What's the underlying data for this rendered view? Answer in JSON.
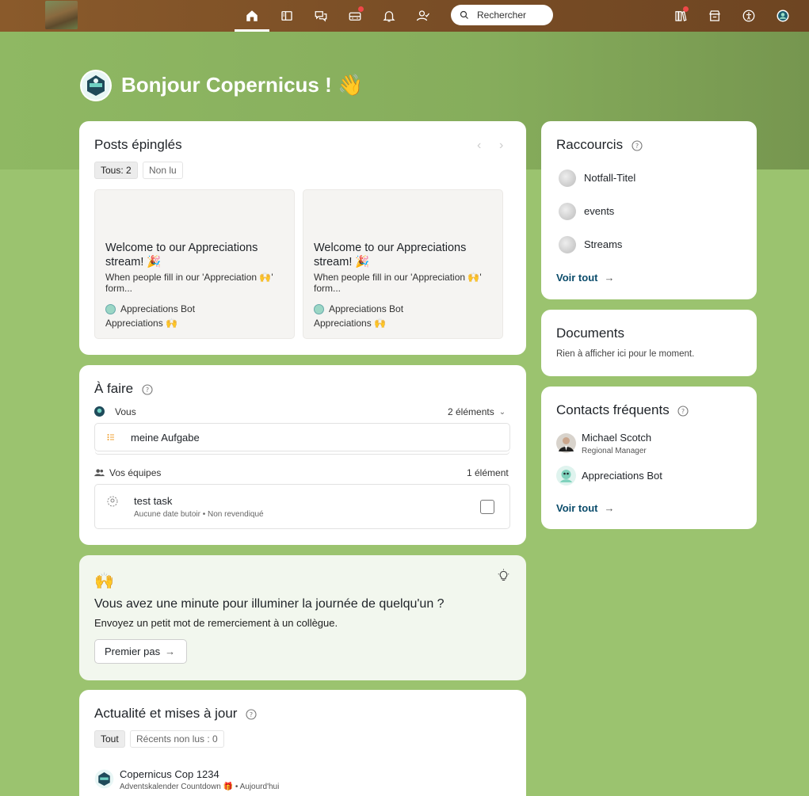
{
  "topbar": {
    "search_placeholder": "Rechercher",
    "nav": [
      "home-icon",
      "sidebar-icon",
      "chat-icon",
      "inbox-icon",
      "bell-icon",
      "people-icon"
    ],
    "right": [
      "library-icon",
      "store-icon",
      "accessibility-icon",
      "profile-icon"
    ]
  },
  "greeting": "Bonjour Copernicus ! 👋",
  "pinned": {
    "title": "Posts épinglés",
    "filter_all": "Tous: 2",
    "filter_unread": "Non lu",
    "posts": [
      {
        "title": "Welcome to our Appreciations stream! 🎉",
        "excerpt": "When people fill in our 'Appreciation 🙌' form...",
        "author": "Appreciations Bot",
        "stream": "Appreciations 🙌"
      },
      {
        "title": "Welcome to our Appreciations stream! 🎉",
        "excerpt": "When people fill in our 'Appreciation 🙌' form...",
        "author": "Appreciations Bot",
        "stream": "Appreciations 🙌"
      }
    ]
  },
  "todo": {
    "title": "À faire",
    "you_label": "Vous",
    "you_count": "2 éléments",
    "task_mine": "meine Aufgabe",
    "teams_label": "Vos équipes",
    "teams_count": "1 élément",
    "team_task": "test task",
    "team_task_meta": "Aucune date butoir • Non revendiqué"
  },
  "appreciate": {
    "emoji": "🙌",
    "title": "Vous avez une minute pour illuminer la journée de quelqu'un ?",
    "subtitle": "Envoyez un petit mot de remerciement à un collègue.",
    "button": "Premier pas"
  },
  "news": {
    "title": "Actualité et mises à jour",
    "filter_all": "Tout",
    "filter_unread": "Récents non lus : 0",
    "item_author": "Copernicus Cop 1234",
    "item_meta": "Adventskalender Countdown 🎁 • Aujourd'hui"
  },
  "shortcuts": {
    "title": "Raccourcis",
    "items": [
      "Notfall-Titel",
      "events",
      "Streams"
    ],
    "see_all": "Voir tout"
  },
  "documents": {
    "title": "Documents",
    "empty": "Rien à afficher ici pour le moment."
  },
  "contacts": {
    "title": "Contacts fréquents",
    "people": [
      {
        "name": "Michael Scotch",
        "role": "Regional Manager"
      },
      {
        "name": "Appreciations Bot",
        "role": ""
      }
    ],
    "see_all": "Voir tout"
  }
}
